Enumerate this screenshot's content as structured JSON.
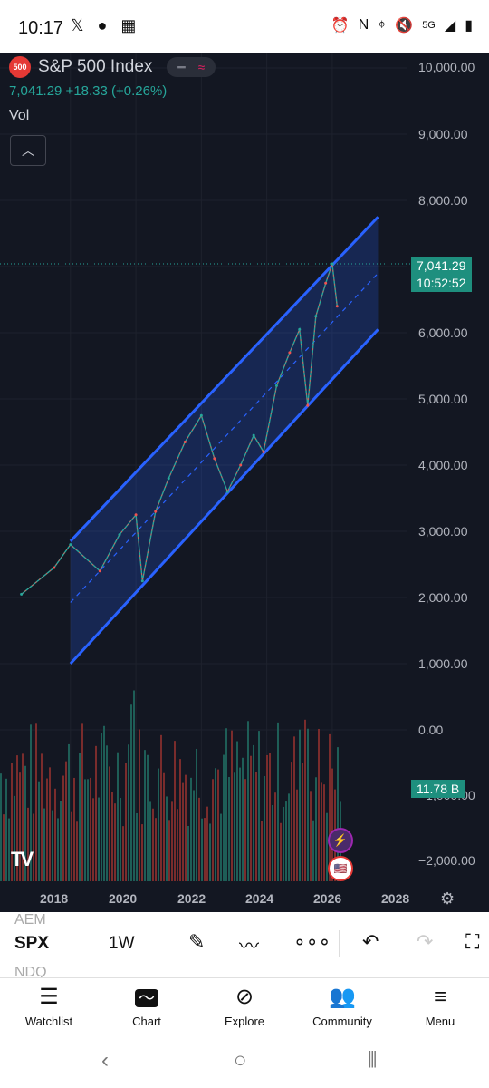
{
  "status": {
    "time": "10:17",
    "icons_left": [
      "x-icon",
      "reddit-icon",
      "gallery-icon"
    ],
    "icons_right": [
      "alarm-icon",
      "nfc-icon",
      "location-icon",
      "mute-icon",
      "5g-icon",
      "signal-icon",
      "battery-icon"
    ],
    "network": "5G"
  },
  "header": {
    "badge": "500",
    "title": "S&P 500 Index",
    "price_line": "7,041.29  +18.33 (+0.26%)",
    "vol_label": "Vol"
  },
  "price_axis": [
    "10,000.00",
    "9,000.00",
    "8,000.00",
    "6,000.00",
    "5,000.00",
    "4,000.00",
    "3,000.00",
    "2,000.00",
    "1,000.00",
    "0.00",
    "−2,000.00"
  ],
  "current_price_tag": "7,041.29",
  "countdown_tag": "10:52:52",
  "volume_tag": "11.78 B",
  "vol_axis_partial": "−1,000.00",
  "time_axis": [
    "2018",
    "2020",
    "2022",
    "2024",
    "2026",
    "2028"
  ],
  "chart_data": {
    "type": "line",
    "title": "S&P 500 Index",
    "x": [
      2016.5,
      2017.5,
      2018.0,
      2018.9,
      2019.5,
      2020.0,
      2020.2,
      2020.6,
      2021.0,
      2021.5,
      2022.0,
      2022.4,
      2022.8,
      2023.2,
      2023.6,
      2023.9,
      2024.3,
      2024.7,
      2025.0,
      2025.25,
      2025.5,
      2025.8,
      2026.0,
      2026.15
    ],
    "values": [
      2050,
      2450,
      2800,
      2400,
      2950,
      3250,
      2250,
      3300,
      3800,
      4350,
      4750,
      4100,
      3600,
      4000,
      4450,
      4200,
      5200,
      5700,
      6050,
      4900,
      6250,
      6750,
      7041,
      6400
    ],
    "ylim": [
      -2000,
      10000
    ],
    "xlim": [
      2016.4,
      2028.3
    ],
    "channel": {
      "x_start": 2018.0,
      "x_end": 2027.4,
      "upper": [
        2850,
        7750
      ],
      "lower": [
        1000,
        6050
      ]
    }
  },
  "toolbar": {
    "symbol": "SPX",
    "symbol_prev": "AEM",
    "symbol_next": "NDQ",
    "resolution": "1W"
  },
  "nav": [
    {
      "label": "Watchlist",
      "icon": "watchlist-icon"
    },
    {
      "label": "Chart",
      "icon": "chart-icon"
    },
    {
      "label": "Explore",
      "icon": "compass-icon"
    },
    {
      "label": "Community",
      "icon": "community-icon"
    },
    {
      "label": "Menu",
      "icon": "menu-icon"
    }
  ],
  "colors": {
    "background": "#131722",
    "channel": "#2962ff",
    "up": "#26a69a",
    "down": "#ef5350"
  }
}
